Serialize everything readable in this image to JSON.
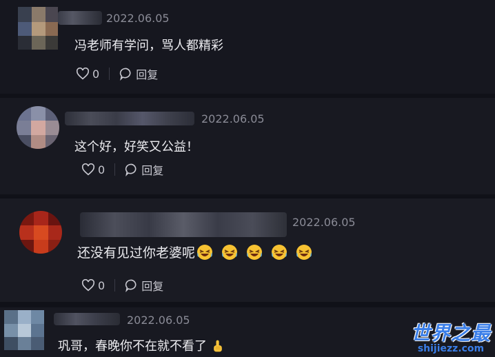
{
  "comments": [
    {
      "date": "2022.06.05",
      "text": "冯老师有学问，骂人都精彩",
      "likes": "0",
      "reply_label": "回复"
    },
    {
      "date": "2022.06.05",
      "text": "这个好，好笑又公益！",
      "likes": "0",
      "reply_label": "回复"
    },
    {
      "date": "2022.06.05",
      "text": "还没有见过你老婆呢",
      "likes": "0",
      "reply_label": "回复",
      "emojis": [
        "laughing-crying-emoji",
        "laughing-crying-emoji",
        "laughing-crying-emoji",
        "laughing-crying-emoji",
        "laughing-crying-emoji"
      ]
    },
    {
      "date": "2022.06.05",
      "text": "巩哥，春晚你不在就不看了",
      "emoji": "pointing-hand-emoji"
    }
  ],
  "watermark": {
    "title": "世界之最",
    "url": "shijiezz.com"
  },
  "colors": {
    "background": "#16171f",
    "accent": "#3a7ee8"
  }
}
